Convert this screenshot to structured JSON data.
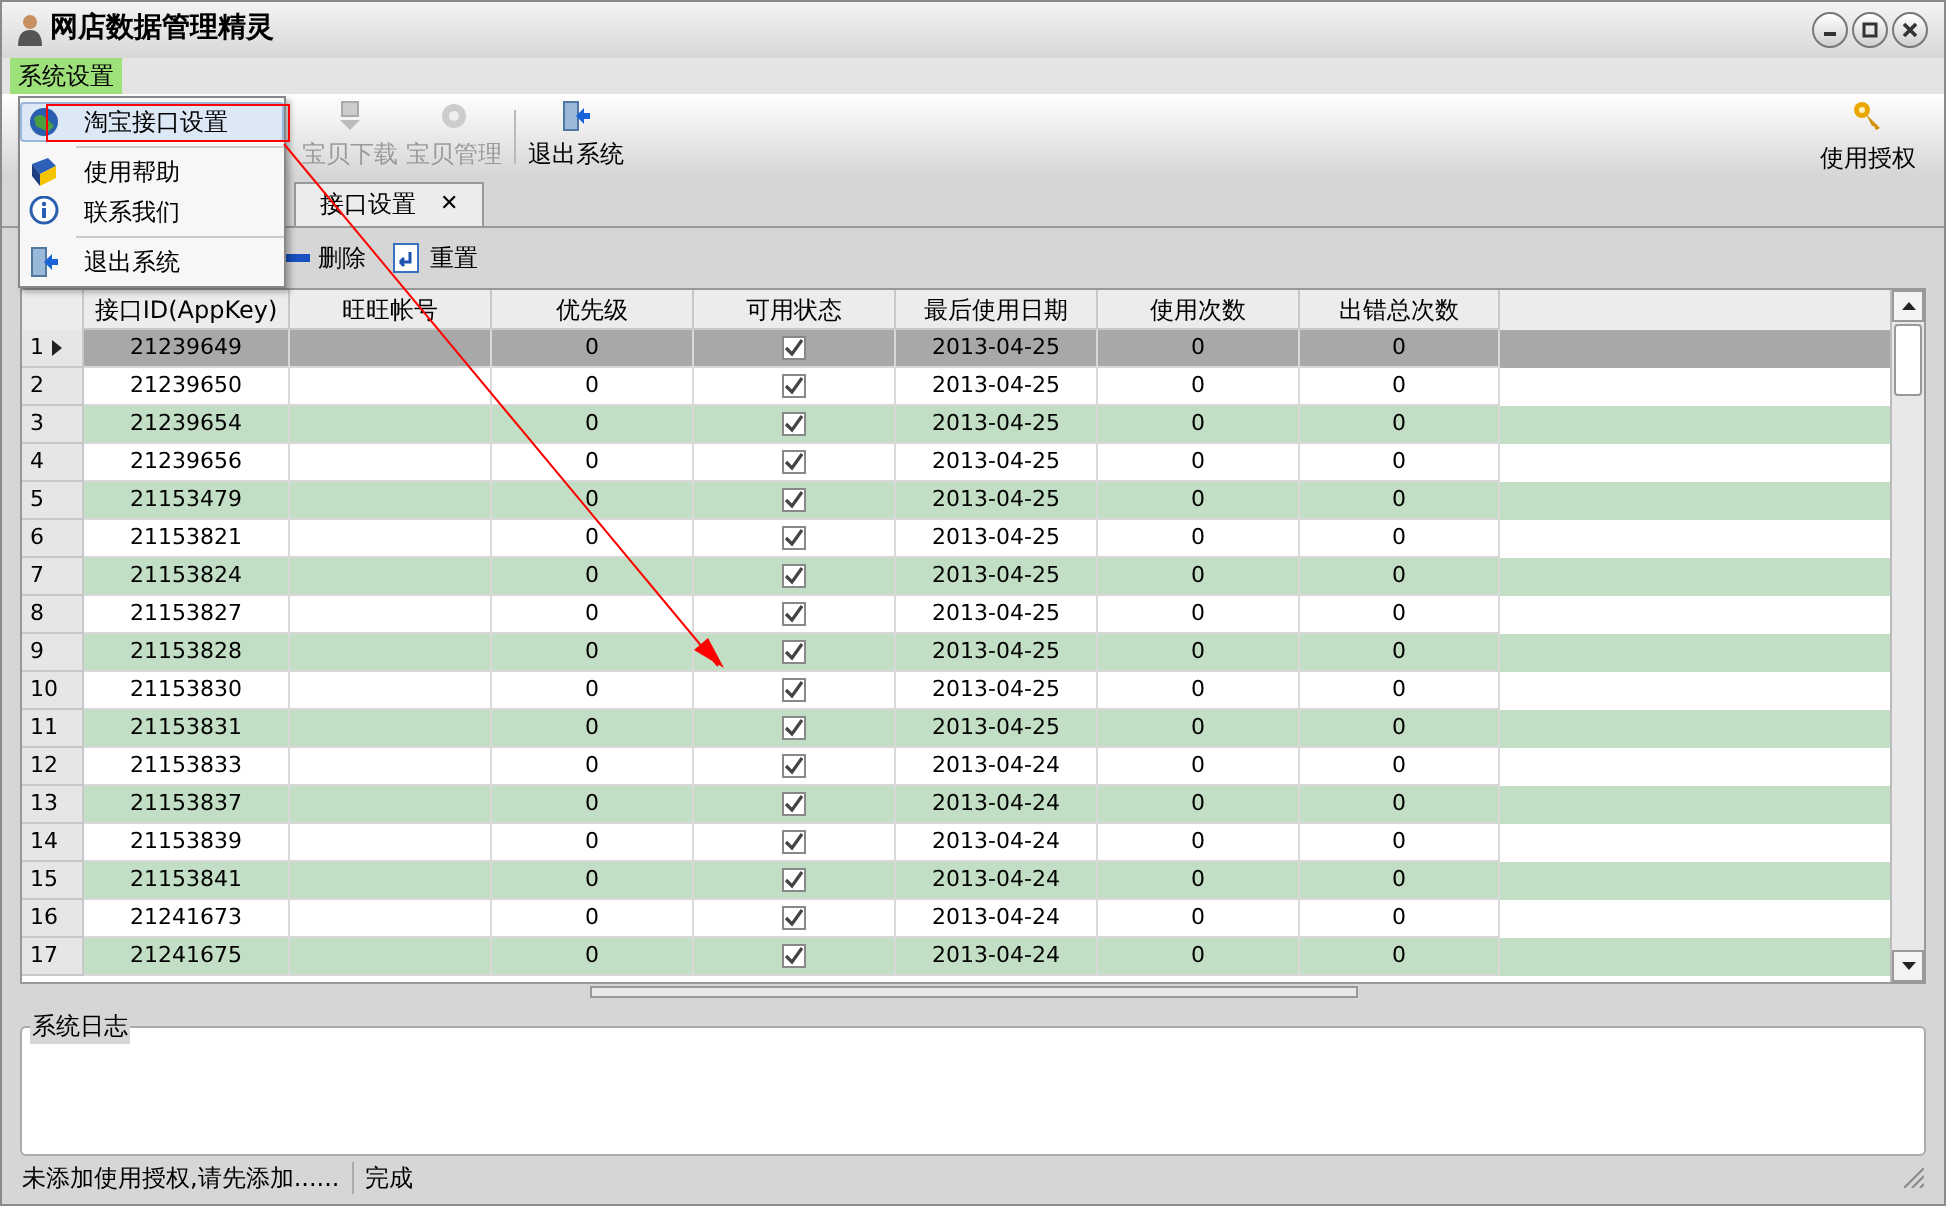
{
  "window": {
    "title": "网店数据管理精灵"
  },
  "menubar": [
    {
      "label": "系统设置",
      "selected": true
    }
  ],
  "menu": {
    "items": [
      {
        "kind": "item",
        "label": "淘宝接口设置",
        "selected": true
      },
      {
        "kind": "separator"
      },
      {
        "kind": "item",
        "label": "使用帮助",
        "selected": false
      },
      {
        "kind": "item",
        "label": "联系我们",
        "selected": false
      },
      {
        "kind": "separator"
      },
      {
        "kind": "item",
        "label": "退出系统",
        "selected": false
      }
    ]
  },
  "toolbar": [
    {
      "label": "宝贝下载",
      "disabled": true
    },
    {
      "label": "宝贝管理",
      "disabled": true
    },
    {
      "label": "退出系统",
      "disabled": false
    }
  ],
  "toolbar_right": {
    "label": "使用授权"
  },
  "tabs": [
    {
      "label": "接口设置",
      "selected": true,
      "close": "✕"
    }
  ],
  "actions": [
    {
      "label": "删除"
    },
    {
      "label": "重置"
    }
  ],
  "table": {
    "columns": [
      "接口ID(AppKey)",
      "旺旺帐号",
      "优先级",
      "可用状态",
      "最后使用日期",
      "使用次数",
      "出错总次数"
    ],
    "rows": [
      {
        "num": "1",
        "selected": true,
        "id": "21239649",
        "priority": "0",
        "checked": true,
        "date": "2013-04-25",
        "uses": "0",
        "errors": "0"
      },
      {
        "num": "2",
        "selected": false,
        "id": "21239650",
        "priority": "0",
        "checked": true,
        "date": "2013-04-25",
        "uses": "0",
        "errors": "0"
      },
      {
        "num": "3",
        "selected": false,
        "id": "21239654",
        "priority": "0",
        "checked": true,
        "date": "2013-04-25",
        "uses": "0",
        "errors": "0"
      },
      {
        "num": "4",
        "selected": false,
        "id": "21239656",
        "priority": "0",
        "checked": true,
        "date": "2013-04-25",
        "uses": "0",
        "errors": "0"
      },
      {
        "num": "5",
        "selected": false,
        "id": "21153479",
        "priority": "0",
        "checked": true,
        "date": "2013-04-25",
        "uses": "0",
        "errors": "0"
      },
      {
        "num": "6",
        "selected": false,
        "id": "21153821",
        "priority": "0",
        "checked": true,
        "date": "2013-04-25",
        "uses": "0",
        "errors": "0"
      },
      {
        "num": "7",
        "selected": false,
        "id": "21153824",
        "priority": "0",
        "checked": true,
        "date": "2013-04-25",
        "uses": "0",
        "errors": "0"
      },
      {
        "num": "8",
        "selected": false,
        "id": "21153827",
        "priority": "0",
        "checked": true,
        "date": "2013-04-25",
        "uses": "0",
        "errors": "0"
      },
      {
        "num": "9",
        "selected": false,
        "id": "21153828",
        "priority": "0",
        "checked": true,
        "date": "2013-04-25",
        "uses": "0",
        "errors": "0"
      },
      {
        "num": "10",
        "selected": false,
        "id": "21153830",
        "priority": "0",
        "checked": true,
        "date": "2013-04-25",
        "uses": "0",
        "errors": "0"
      },
      {
        "num": "11",
        "selected": false,
        "id": "21153831",
        "priority": "0",
        "checked": true,
        "date": "2013-04-25",
        "uses": "0",
        "errors": "0"
      },
      {
        "num": "12",
        "selected": false,
        "id": "21153833",
        "priority": "0",
        "checked": true,
        "date": "2013-04-24",
        "uses": "0",
        "errors": "0"
      },
      {
        "num": "13",
        "selected": false,
        "id": "21153837",
        "priority": "0",
        "checked": true,
        "date": "2013-04-24",
        "uses": "0",
        "errors": "0"
      },
      {
        "num": "14",
        "selected": false,
        "id": "21153839",
        "priority": "0",
        "checked": true,
        "date": "2013-04-24",
        "uses": "0",
        "errors": "0"
      },
      {
        "num": "15",
        "selected": false,
        "id": "21153841",
        "priority": "0",
        "checked": true,
        "date": "2013-04-24",
        "uses": "0",
        "errors": "0"
      },
      {
        "num": "16",
        "selected": false,
        "id": "21241673",
        "priority": "0",
        "checked": true,
        "date": "2013-04-24",
        "uses": "0",
        "errors": "0"
      },
      {
        "num": "17",
        "selected": false,
        "id": "21241675",
        "priority": "0",
        "checked": true,
        "date": "2013-04-24",
        "uses": "0",
        "errors": "0"
      }
    ]
  },
  "log": {
    "title": "系统日志"
  },
  "status_bar": [
    "未添加使用授权,请先添加......",
    "完成"
  ]
}
